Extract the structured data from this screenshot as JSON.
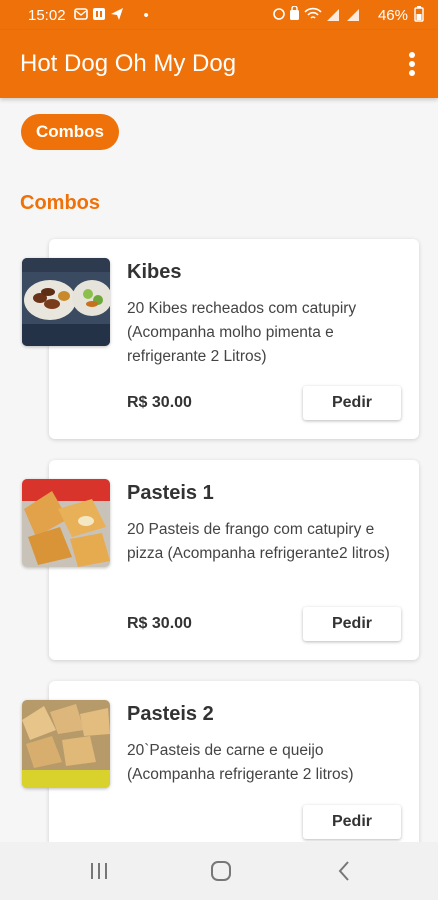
{
  "status_bar": {
    "time": "15:02",
    "battery": "46%",
    "dot": "•"
  },
  "app_bar": {
    "title": "Hot Dog Oh My Dog",
    "menu_icon": "more-vert-icon"
  },
  "filter_chip": {
    "label": "Combos"
  },
  "section": {
    "title": "Combos"
  },
  "products": [
    {
      "name": "Kibes",
      "description": "20 Kibes recheados com catupiry (Acompanha molho pimenta e refrigerante 2 Litros)",
      "price": "R$ 30.00",
      "order_label": "Pedir"
    },
    {
      "name": "Pasteis 1",
      "description": "20 Pasteis de frango com catupiry e pizza (Acompanha refrigerante2 litros)",
      "price": "R$ 30.00",
      "order_label": "Pedir"
    },
    {
      "name": "Pasteis 2",
      "description": "20`Pasteis de carne e queijo (Acompanha refrigerante 2 litros)",
      "order_label": "Pedir"
    }
  ],
  "colors": {
    "accent": "#ef7109",
    "background": "#f6f6f6",
    "card": "#ffffff"
  }
}
